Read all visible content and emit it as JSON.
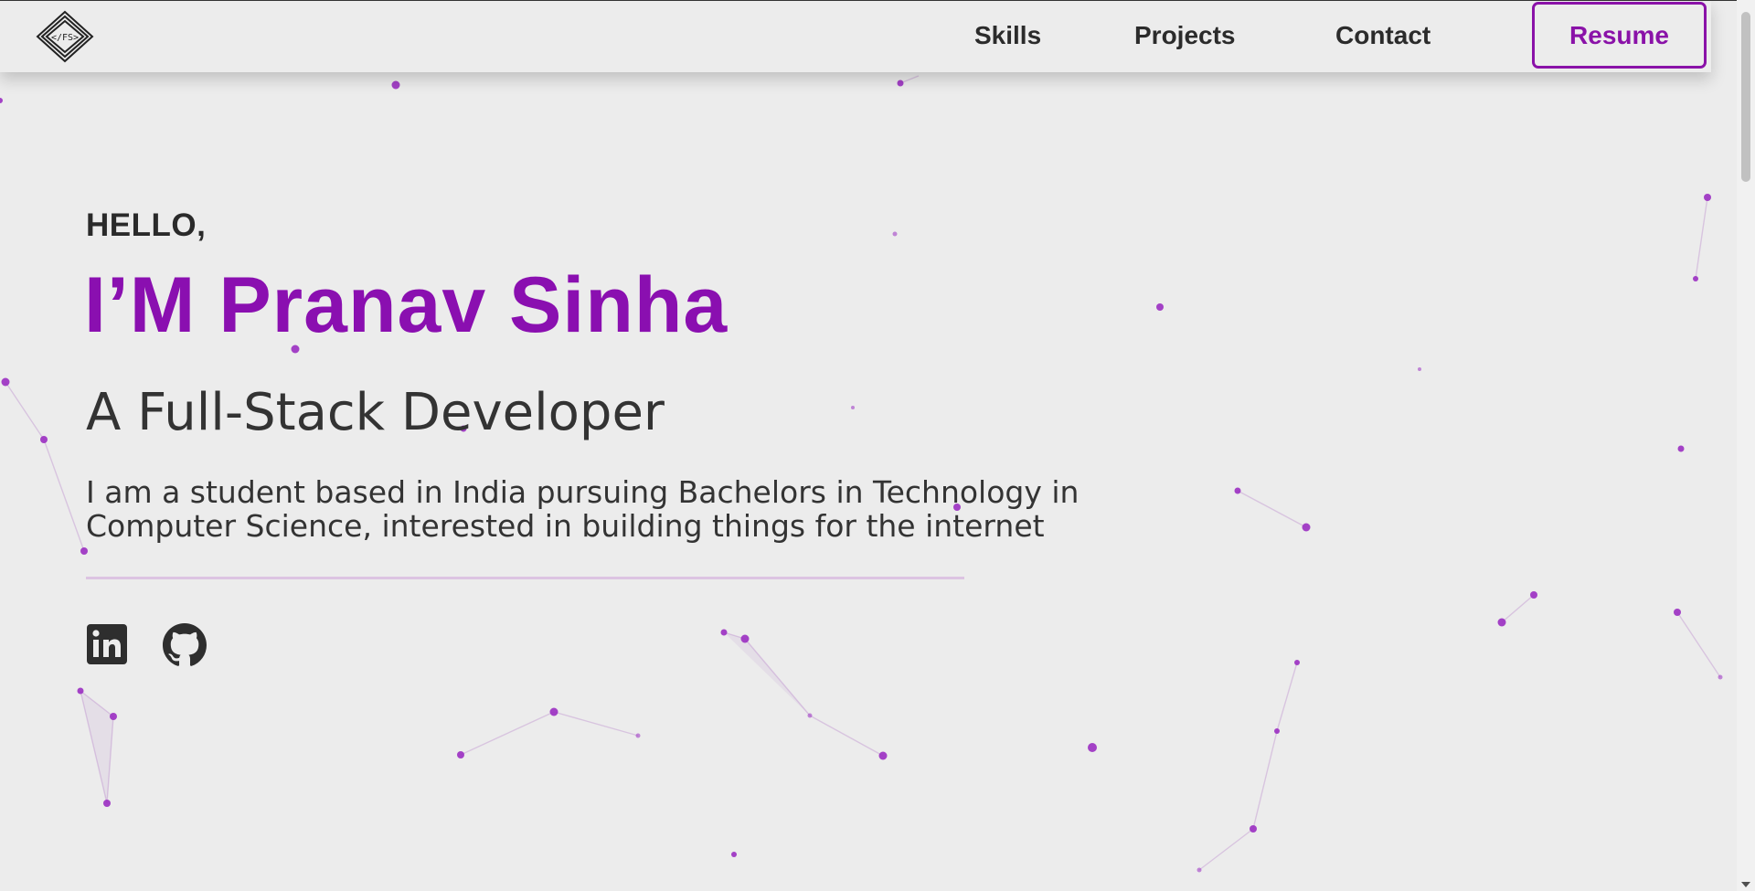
{
  "nav": {
    "logo_text": "</FS>",
    "links": [
      "Skills",
      "Projects",
      "Contact"
    ],
    "resume_label": "Resume"
  },
  "hero": {
    "greeting": "HELLO,",
    "name": "I’M Pranav Sinha",
    "role": "A Full-Stack Developer",
    "bio": "I am a student based in India pursuing Bachelors in Technology in Computer Science, interested in building things for the internet"
  },
  "socials": [
    {
      "name": "LinkedIn",
      "icon": "linkedin-icon"
    },
    {
      "name": "GitHub",
      "icon": "github-icon"
    }
  ],
  "colors": {
    "accent": "#8a0fb0",
    "background": "#ececec",
    "text": "#2b2b2b",
    "particle": "#9b2fc2"
  }
}
